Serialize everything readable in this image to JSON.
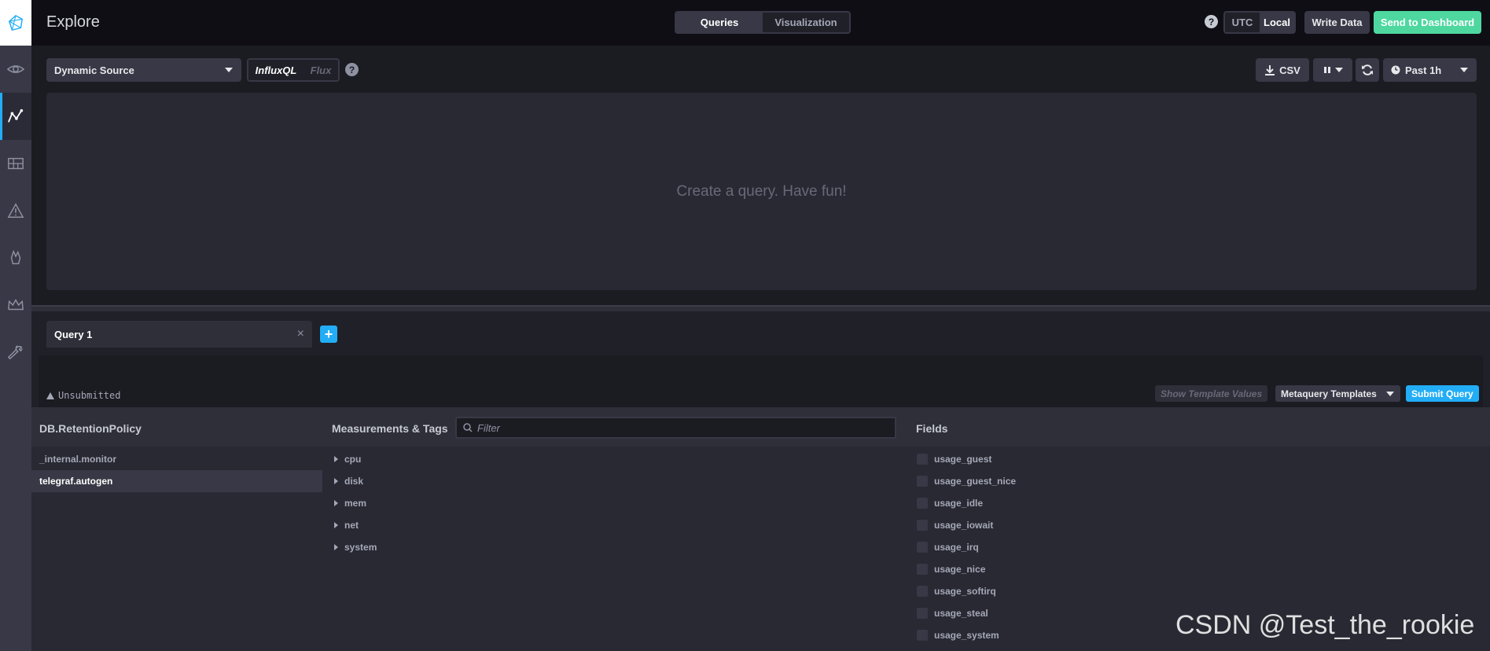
{
  "header": {
    "title": "Explore",
    "tabs": [
      "Queries",
      "Visualization"
    ],
    "help": "?",
    "timezone": [
      "UTC",
      "Local"
    ],
    "write_data": "Write Data",
    "send_to_dashboard": "Send to Dashboard"
  },
  "toolbar": {
    "source": "Dynamic Source",
    "languages": [
      "InfluxQL",
      "Flux"
    ],
    "help": "?",
    "csv": "CSV",
    "time_range": "Past 1h"
  },
  "graph": {
    "empty_message": "Create a query. Have fun!"
  },
  "query": {
    "tab_label": "Query 1",
    "close": "×",
    "add": "+",
    "status": "Unsubmitted",
    "show_template_values": "Show Template Values",
    "metaquery_templates": "Metaquery Templates",
    "submit": "Submit Query"
  },
  "browser": {
    "db_header": "DB.RetentionPolicy",
    "measurements_header": "Measurements & Tags",
    "filter_placeholder": "Filter",
    "fields_header": "Fields",
    "databases": [
      "_internal.monitor",
      "telegraf.autogen"
    ],
    "measurements": [
      "cpu",
      "disk",
      "mem",
      "net",
      "system"
    ],
    "fields": [
      "usage_guest",
      "usage_guest_nice",
      "usage_idle",
      "usage_iowait",
      "usage_irq",
      "usage_nice",
      "usage_softirq",
      "usage_steal",
      "usage_system"
    ]
  },
  "watermark": "CSDN @Test_the_rookie",
  "colors": {
    "accent_blue": "#22adf6",
    "accent_green": "#4ed8a0",
    "background": "#292933"
  }
}
